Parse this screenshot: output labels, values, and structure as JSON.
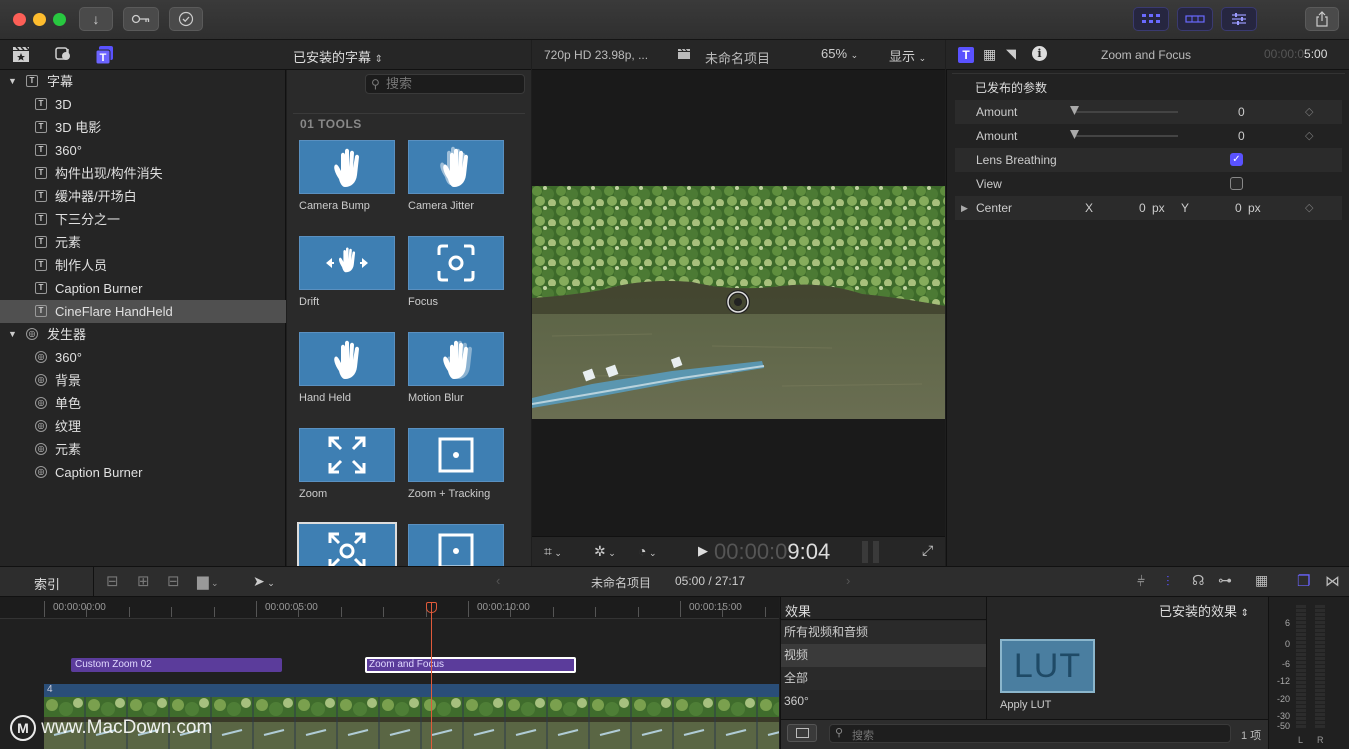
{
  "toolbar": {
    "import_icon": "download-arrow-icon",
    "keywords_icon": "key-icon",
    "background_tasks_icon": "checkmark-circle-icon",
    "share_icon": "share-icon"
  },
  "browser": {
    "library_title": "已安装的字幕",
    "search_placeholder": "搜索",
    "section_title": "01 TOOLS"
  },
  "sidebar": {
    "captions_group": "字幕",
    "captions_items": [
      "3D",
      "3D 电影",
      "360°",
      "构件出现/构件消失",
      "缓冲器/开场白",
      "下三分之一",
      "元素",
      "制作人员",
      "Caption Burner",
      "CineFlare HandHeld"
    ],
    "generators_group": "发生器",
    "generators_items": [
      "360°",
      "背景",
      "单色",
      "纹理",
      "元素",
      "Caption Burner"
    ]
  },
  "tiles": [
    {
      "label": "Camera Bump",
      "icon": "hand-icon"
    },
    {
      "label": "Camera Jitter",
      "icon": "hand-jitter-icon"
    },
    {
      "label": "Drift",
      "icon": "hand-arrows-icon"
    },
    {
      "label": "Focus",
      "icon": "focus-icon"
    },
    {
      "label": "Hand Held",
      "icon": "hand-icon"
    },
    {
      "label": "Motion Blur",
      "icon": "hand-blur-icon"
    },
    {
      "label": "Zoom",
      "icon": "expand-arrows-icon"
    },
    {
      "label": "Zoom + Tracking",
      "icon": "target-square-icon"
    },
    {
      "label": "",
      "icon": "zoom-focus-icon"
    },
    {
      "label": "",
      "icon": "target-square-icon"
    }
  ],
  "viewer": {
    "format": "720p HD 23.98p, ...",
    "project_name": "未命名项目",
    "zoom": "65%",
    "display_menu": "显示",
    "timecode_dim": "00:00:0",
    "timecode_bright": "9:04"
  },
  "inspector": {
    "title": "Zoom and Focus",
    "duration_dim": "00:00:0",
    "duration_bright": "5:00",
    "section": "已发布的参数",
    "params": [
      {
        "name": "Amount",
        "value": "0"
      },
      {
        "name": "Amount",
        "value": "0"
      }
    ],
    "lens_breathing": "Lens Breathing",
    "lens_breathing_checked": true,
    "view": "View",
    "view_checked": false,
    "center": "Center",
    "center_x_label": "X",
    "center_x": "0",
    "center_y_label": "Y",
    "center_y": "0",
    "unit": "px"
  },
  "timeline_bar": {
    "index_label": "索引",
    "project_name": "未命名项目",
    "position": "05:00 / 27:17"
  },
  "timeline": {
    "ruler": [
      "00:00:00:00",
      "00:00:05:00",
      "00:00:10:00",
      "00:00:15:00"
    ],
    "clip1": "Custom Zoom 02",
    "clip2": "Zoom and Focus",
    "track_num": "4",
    "watermark": "www.MacDown.com"
  },
  "effects": {
    "title": "效果",
    "installed_title": "已安装的效果",
    "categories": [
      "所有视频和音频",
      "视频",
      "全部",
      "360°"
    ],
    "lut_label": "Apply LUT",
    "lut_thumb": "LUT",
    "search_placeholder": "搜索",
    "count": "1 项"
  },
  "meter": {
    "scale": [
      "6",
      "0",
      "-6",
      "-12",
      "-20",
      "-30",
      "-50"
    ],
    "left": "L",
    "right": "R"
  }
}
